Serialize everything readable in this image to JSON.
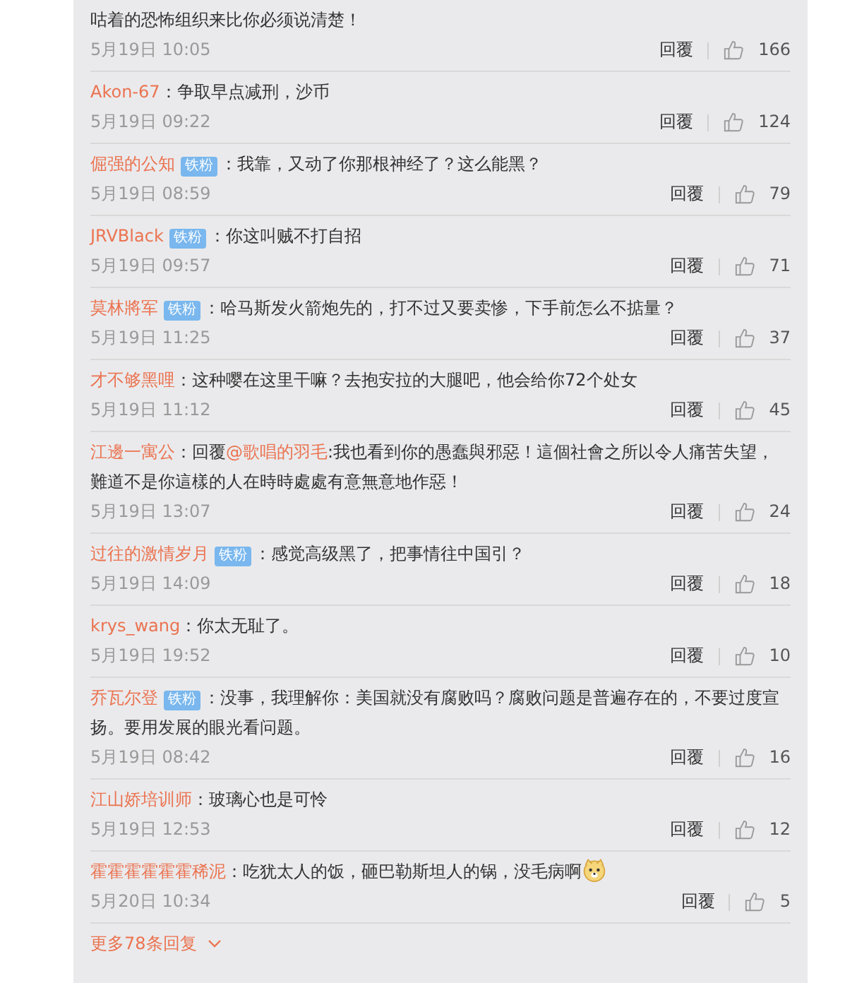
{
  "comments": [
    {
      "content": [
        {
          "kind": "plain",
          "text": "咕着的恐怖组织来比你必须说清楚！"
        }
      ],
      "date": "5月19日 10:05",
      "reply": "回覆",
      "likes": "166"
    },
    {
      "user": "Akon-67",
      "content": [
        {
          "kind": "plain",
          "text": "：争取早点减刑，沙币"
        }
      ],
      "date": "5月19日 09:22",
      "reply": "回覆",
      "likes": "124"
    },
    {
      "user": "倔强的公知",
      "badge": "铁粉",
      "content": [
        {
          "kind": "plain",
          "text": "：我靠，又动了你那根神经了？这么能黑？"
        }
      ],
      "date": "5月19日 08:59",
      "reply": "回覆",
      "likes": "79"
    },
    {
      "user": "JRVBlack",
      "badge": "铁粉",
      "content": [
        {
          "kind": "plain",
          "text": "：你这叫贼不打自招"
        }
      ],
      "date": "5月19日 09:57",
      "reply": "回覆",
      "likes": "71"
    },
    {
      "user": "莫林將军",
      "badge": "铁粉",
      "content": [
        {
          "kind": "plain",
          "text": "：哈马斯发火箭炮先的，打不过又要卖惨，下手前怎么不掂量？"
        }
      ],
      "date": "5月19日 11:25",
      "reply": "回覆",
      "likes": "37"
    },
    {
      "user": "才不够黑哩",
      "content": [
        {
          "kind": "plain",
          "text": "：这种嘤在这里干嘛？去抱安拉的大腿吧，他会给你72个处女"
        }
      ],
      "date": "5月19日 11:12",
      "reply": "回覆",
      "likes": "45"
    },
    {
      "user": "江邊一寓公",
      "content": [
        {
          "kind": "plain",
          "text": "：回覆"
        },
        {
          "kind": "mention",
          "text": "@歌唱的羽毛"
        },
        {
          "kind": "plain",
          "text": ":我也看到你的愚蠢與邪惡！這個社會之所以令人痛苦失望，難道不是你這樣的人在時時處處有意無意地作惡！"
        }
      ],
      "date": "5月19日 13:07",
      "reply": "回覆",
      "likes": "24"
    },
    {
      "user": "过往的激情岁月",
      "badge": "铁粉",
      "content": [
        {
          "kind": "plain",
          "text": "：感觉高级黑了，把事情往中国引？"
        }
      ],
      "date": "5月19日 14:09",
      "reply": "回覆",
      "likes": "18"
    },
    {
      "user": "krys_wang",
      "content": [
        {
          "kind": "plain",
          "text": "：你太无耻了。"
        }
      ],
      "date": "5月19日 19:52",
      "reply": "回覆",
      "likes": "10"
    },
    {
      "user": "乔瓦尔登",
      "badge": "铁粉",
      "content": [
        {
          "kind": "plain",
          "text": "：没事，我理解你：美国就没有腐败吗？腐败问题是普遍存在的，不要过度宣扬。要用发展的眼光看问题。"
        }
      ],
      "date": "5月19日 08:42",
      "reply": "回覆",
      "likes": "16"
    },
    {
      "user": "江山娇培训师",
      "content": [
        {
          "kind": "plain",
          "text": "：玻璃心也是可怜"
        }
      ],
      "date": "5月19日 12:53",
      "reply": "回覆",
      "likes": "12"
    },
    {
      "user": "霍霍霍霍霍霍稀泥",
      "content": [
        {
          "kind": "plain",
          "text": "：吃犹太人的饭，砸巴勒斯坦人的锅，没毛病啊"
        },
        {
          "kind": "emoji"
        }
      ],
      "date": "5月20日 10:34",
      "reply": "回覆",
      "likes": "5"
    }
  ],
  "more": {
    "label": "更多78条回复"
  }
}
